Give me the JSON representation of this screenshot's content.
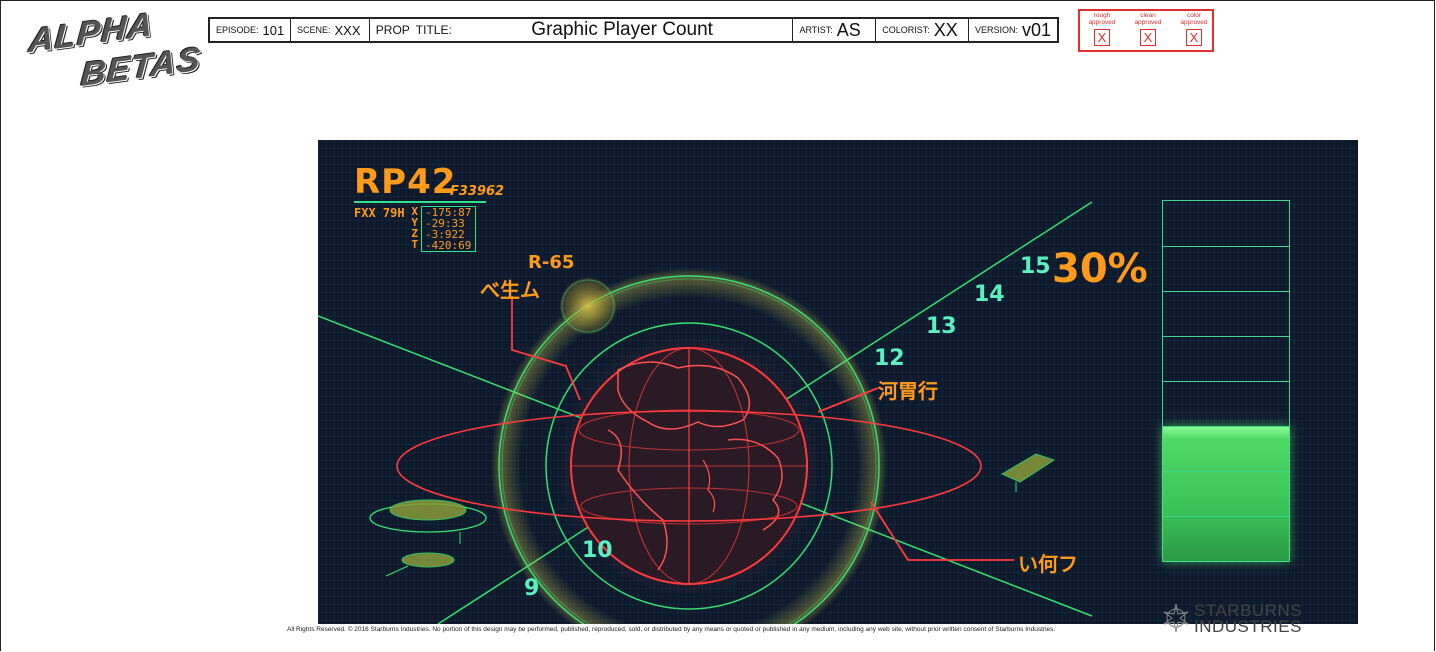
{
  "logo": {
    "line1": "ALPHA",
    "line2": "BETAS"
  },
  "header": {
    "episode_label": "EPISODE:",
    "episode_value": "101",
    "scene_label": "SCENE:",
    "scene_value": "XXX",
    "prop_label": "PROP",
    "title_label": "TITLE:",
    "title_value": "Graphic Player Count",
    "artist_label": "ARTIST:",
    "artist_value": "AS",
    "colorist_label": "COLORIST:",
    "colorist_value": "XX",
    "version_label": "VERSION:",
    "version_value": "v01"
  },
  "approvals": [
    {
      "label1": "rough",
      "label2": "approved",
      "mark": "X"
    },
    {
      "label1": "clean",
      "label2": "approved",
      "mark": "X"
    },
    {
      "label1": "color",
      "label2": "approved",
      "mark": "X"
    }
  ],
  "hud": {
    "code": "RP42",
    "code_sub": "F33962",
    "fxx": "FXX 79H",
    "axes": [
      "X",
      "Y",
      "Z",
      "T"
    ],
    "coords": [
      "-175:87",
      "-29:33",
      "-3:922",
      "-420:69"
    ],
    "marker_id": "R-65",
    "jp_label_1": "べ生ム",
    "jp_label_2": "河胃行",
    "jp_label_3": "い何フ",
    "scale_numbers": [
      "9",
      "10",
      "12",
      "13",
      "14",
      "15"
    ],
    "percent": "30%",
    "meter_fill": 0.3,
    "meter_segments": 8,
    "colors": {
      "background": "#0f1b2d",
      "orange": "#ff9a1a",
      "green": "#3fd68a",
      "red": "#ff3b3b",
      "teal": "#5cf0c0"
    }
  },
  "footer": {
    "legal": "All Rights Reserved.  © 2016 Starburns Industries.  No portion of this design may be performed, published, reproduced, sold, or distributed by any means or quoted or published in any medium, including any web site, without prior written consent of Starburns Industries.",
    "company_line1": "STARBURNS",
    "company_line2": "INDUSTRIES"
  }
}
